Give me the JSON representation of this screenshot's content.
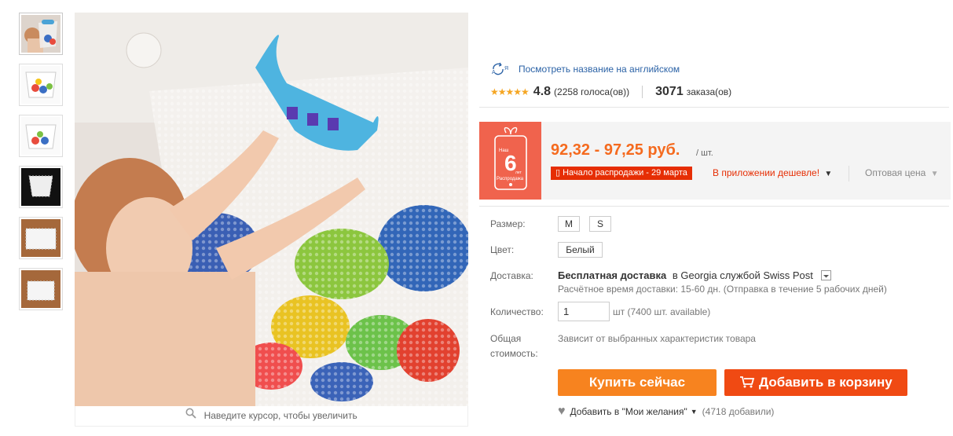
{
  "gallery": {
    "thumbnails": [
      {
        "name": "thumb-child-bath",
        "active": true
      },
      {
        "name": "thumb-net-toys",
        "active": false
      },
      {
        "name": "thumb-net-white",
        "active": false
      },
      {
        "name": "thumb-net-black",
        "active": false
      },
      {
        "name": "thumb-net-wood",
        "active": false
      },
      {
        "name": "thumb-net-wood-2",
        "active": false
      }
    ],
    "zoom_hint": "Наведите курсор, чтобы увеличить"
  },
  "translate_link": "Посмотреть название на английском",
  "rating": {
    "stars": "★★★★★",
    "value": "4.8",
    "votes": "(2258 голоса(ов))",
    "orders_count": "3071",
    "orders_label": "заказа(ов)"
  },
  "price": {
    "range": "92,32 - 97,25 руб.",
    "unit": "/ шт.",
    "sale_tag": "Начало распродажи - 29 марта",
    "app_cheaper": "В приложении дешевле!",
    "wholesale": "Оптовая цена",
    "badge": {
      "top": "Наш",
      "number": "6",
      "sub": "лет",
      "label": "Распродажа"
    }
  },
  "options": {
    "size_label": "Размер:",
    "sizes": [
      "M",
      "S"
    ],
    "color_label": "Цвет:",
    "color_value": "Белый",
    "shipping_label": "Доставка:",
    "shipping_free": "Бесплатная доставка",
    "shipping_rest": "в Georgia службой Swiss Post",
    "shipping_time": "Расчётное время доставки: 15-60 дн. (Отправка в течение 5 рабочих дней)",
    "qty_label": "Количество:",
    "qty_value": "1",
    "qty_unit": "шт (7400 шт. available)",
    "total_label_1": "Общая",
    "total_label_2": "стоимость:",
    "total_value": "Зависит от выбранных характеристик товара"
  },
  "actions": {
    "buy_now": "Купить сейчас",
    "add_to_cart": "Добавить в корзину",
    "wishlist": "Добавить в \"Мои желания\"",
    "wishlist_count": "(4718 добавили)"
  },
  "colors": {
    "price": "#f56a1e",
    "buy_button": "#f7831f",
    "cart_button": "#f04a13",
    "sale_tag": "#e62e04",
    "badge": "#f0634d",
    "link": "#2b62a6",
    "stars": "#f5a623"
  }
}
